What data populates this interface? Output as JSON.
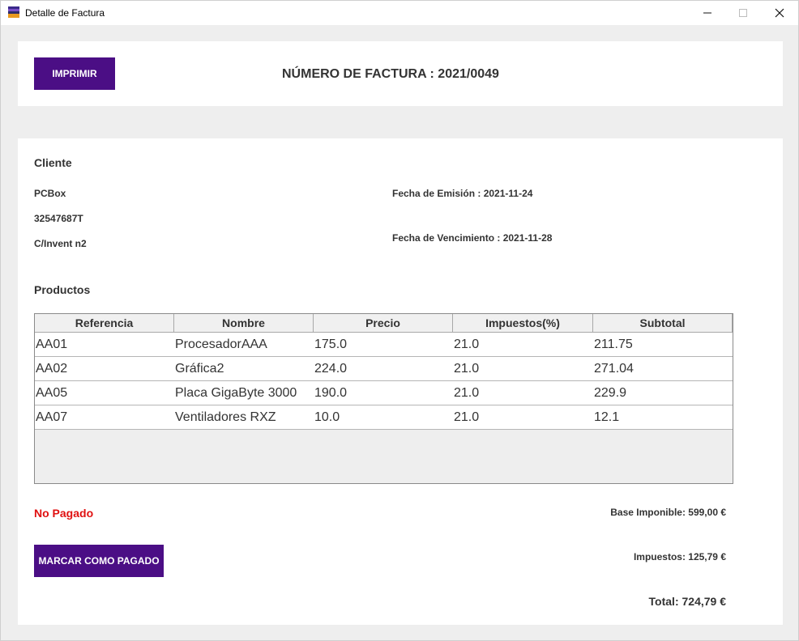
{
  "window": {
    "title": "Detalle de Factura",
    "controls": {
      "minimize": "—",
      "maximize": "☐",
      "close": "✕"
    }
  },
  "header": {
    "print_label": "IMPRIMIR",
    "invoice_title": "NÚMERO DE FACTURA : 2021/0049"
  },
  "client": {
    "section_label": "Cliente",
    "name": "PCBox",
    "tax_id": "32547687T",
    "address": "C/Invent n2"
  },
  "dates": {
    "emission": "Fecha de Emisión : 2021-11-24",
    "due": "Fecha de Vencimiento : 2021-11-28"
  },
  "products": {
    "section_label": "Productos",
    "columns": [
      "Referencia",
      "Nombre",
      "Precio",
      "Impuestos(%)",
      "Subtotal"
    ],
    "rows": [
      [
        "AA01",
        "ProcesadorAAA",
        "175.0",
        "21.0",
        "211.75"
      ],
      [
        "AA02",
        "Gráfica2",
        "224.0",
        "21.0",
        "271.04"
      ],
      [
        "AA05",
        "Placa GigaByte 3000",
        "190.0",
        "21.0",
        "229.9"
      ],
      [
        "AA07",
        "Ventiladores RXZ",
        "10.0",
        "21.0",
        "12.1"
      ]
    ]
  },
  "payment": {
    "status": "No Pagado",
    "status_color": "#e01010",
    "mark_paid_label": "MARCAR COMO PAGADO"
  },
  "totals": {
    "base": "Base Imponible: 599,00 €",
    "taxes": "Impuestos: 125,79 €",
    "total": "Total: 724,79 €"
  },
  "colors": {
    "accent": "#4b0e85",
    "background": "#eeeeee",
    "panel": "#ffffff"
  }
}
